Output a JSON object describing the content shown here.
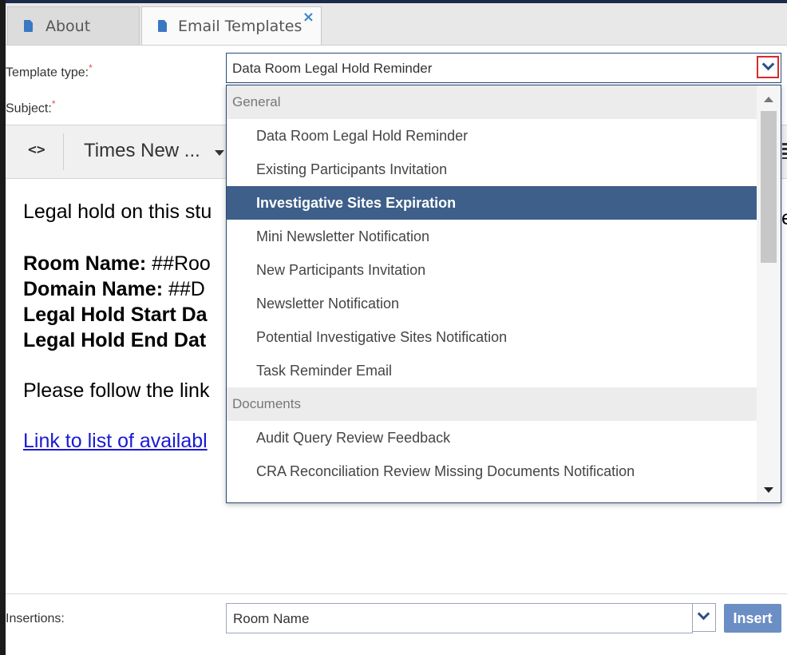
{
  "tabs": [
    {
      "label": "About"
    },
    {
      "label": "Email Templates",
      "close": "×"
    }
  ],
  "form": {
    "template_type_label": "Template type:",
    "subject_label": "Subject:",
    "required_mark": "*",
    "template_type_value": "Data Room Legal Hold Reminder"
  },
  "toolbar": {
    "code_label": "<>",
    "font_value": "Times New ..."
  },
  "editor": {
    "line1": "Legal hold on this stu",
    "line1_tail": "e",
    "room_label": "Room Name:",
    "room_value": " ##Roo",
    "domain_label": "Domain Name:",
    "domain_value": " ##D",
    "start_label": "Legal Hold Start Da",
    "end_label": "Legal Hold End Dat",
    "follow_text": "Please follow the link",
    "link_text": "Link to list of availabl"
  },
  "insertions": {
    "label": "Insertions:",
    "value": "Room Name",
    "insert_button": "Insert"
  },
  "dropdown": {
    "groups": [
      {
        "label": "General",
        "items": [
          "Data Room Legal Hold Reminder",
          "Existing Participants Invitation",
          "Investigative Sites Expiration",
          "Mini Newsletter Notification",
          "New Participants Invitation",
          "Newsletter Notification",
          "Potential Investigative Sites Notification",
          "Task Reminder Email"
        ]
      },
      {
        "label": "Documents",
        "items": [
          "Audit Query Review Feedback",
          "CRA Reconciliation Review Missing Documents Notification"
        ]
      }
    ],
    "selected_item": "Investigative Sites Expiration"
  },
  "colors": {
    "accent": "#3e5f8a",
    "required": "#d9534f",
    "link": "#1a1ad4",
    "insert_button": "#6b8fc4"
  }
}
